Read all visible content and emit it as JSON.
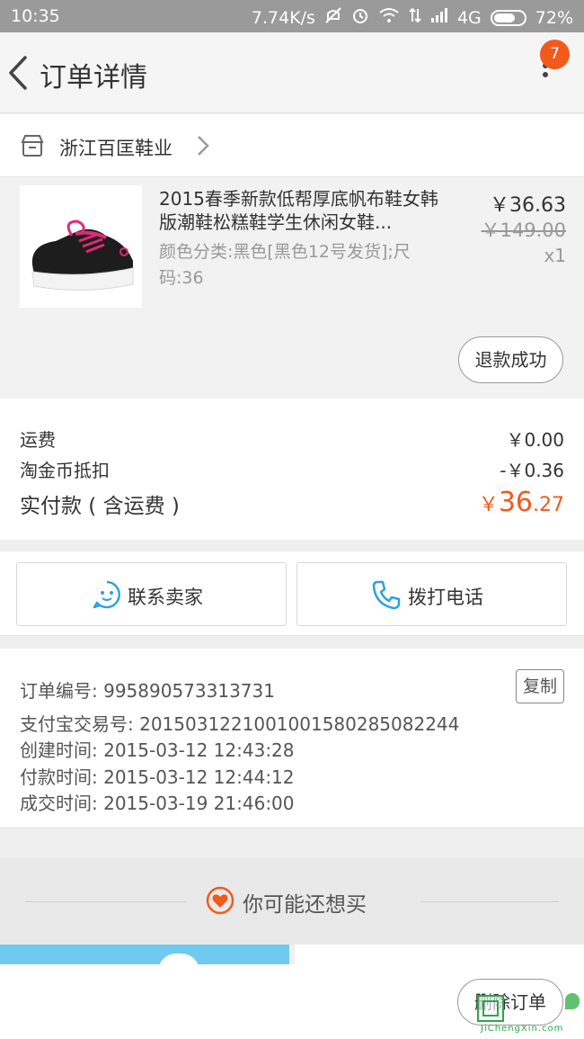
{
  "status_bar": {
    "time": "10:35",
    "network_speed": "7.74K/s",
    "network_type": "4G",
    "battery_percent": "72%",
    "battery_level": 0.72
  },
  "nav": {
    "title": "订单详情",
    "badge_count": "7"
  },
  "shop": {
    "name": "浙江百匡鞋业"
  },
  "item": {
    "title": "2015春季新款低帮厚底帆布鞋女韩版潮鞋松糕鞋学生休闲女鞋...",
    "spec": "颜色分类:黑色[黑色12号发货];尺码:36",
    "price": "￥36.63",
    "original_price": "￥149.00",
    "quantity": "x1",
    "status_button": "退款成功"
  },
  "summary": {
    "shipping_label": "运费",
    "shipping_value": "￥0.00",
    "coin_label": "淘金币抵扣",
    "coin_value": "-￥0.36",
    "paid_label": "实付款 ( 含运费 )",
    "paid_symbol": "￥",
    "paid_integer": "36",
    "paid_decimal": ".27"
  },
  "actions": {
    "contact_seller": "联系卖家",
    "call_phone": "拨打电话"
  },
  "order_info": {
    "order_no": "订单编号: 995890573313731",
    "copy_button": "复制",
    "alipay_no": "支付宝交易号: 2015031221001001580285082244",
    "created": "创建时间: 2015-03-12 12:43:28",
    "paid": "付款时间: 2015-03-12 12:44:12",
    "completed": "成交时间: 2015-03-19 21:46:00"
  },
  "recommend": {
    "title": "你可能还想买"
  },
  "bottom_bar": {
    "delete_order": "删除订单"
  },
  "watermark": {
    "text": "JiChengXin.com"
  },
  "colors": {
    "accent": "#f25a1c",
    "icon_blue": "#2aa1e0",
    "status_bar": "#9a9a9a"
  },
  "icons": [
    "back-arrow-icon",
    "more-vertical-icon",
    "store-icon",
    "chevron-right-icon",
    "chat-bubble-icon",
    "phone-icon",
    "heart-icon"
  ]
}
